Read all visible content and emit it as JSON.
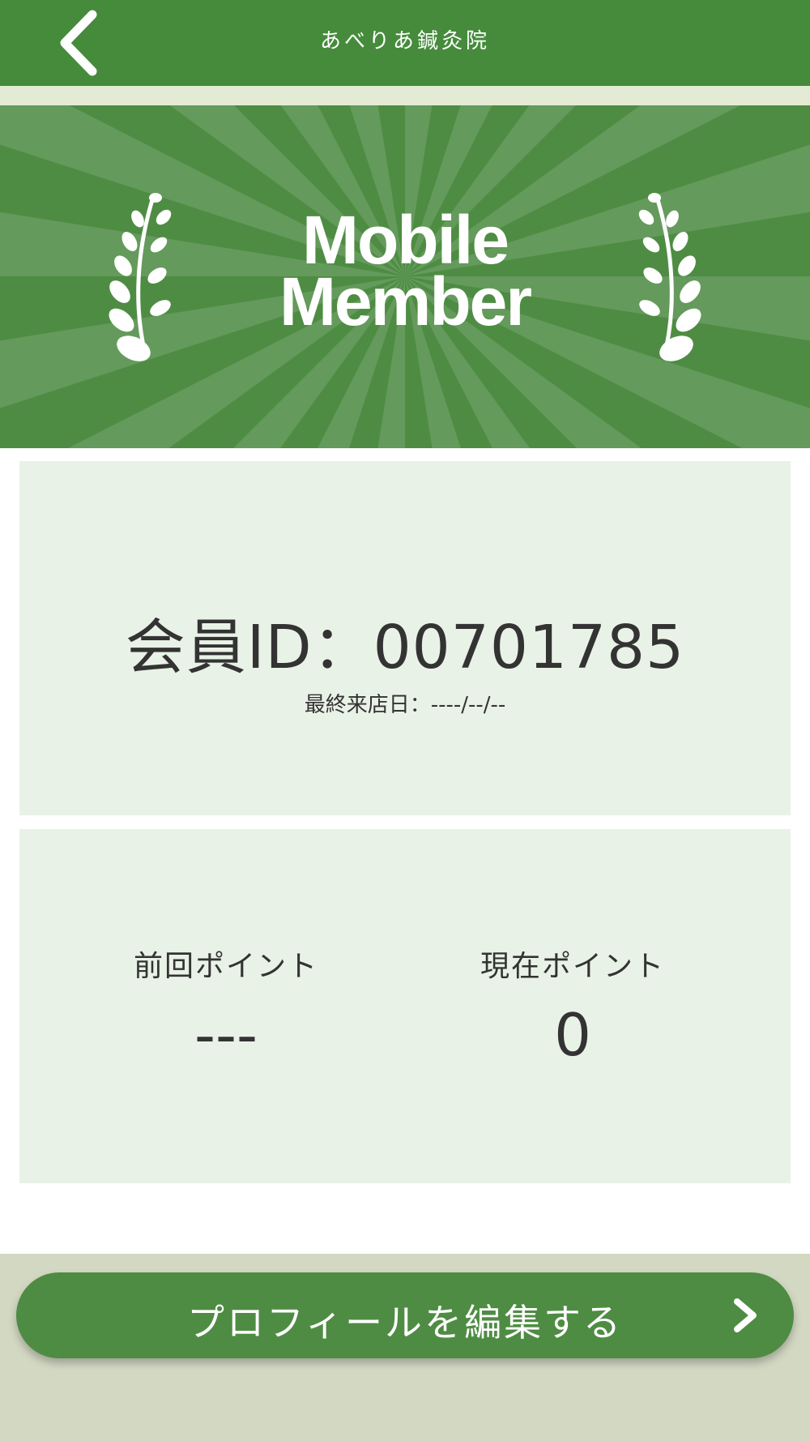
{
  "header": {
    "title": "あべりあ鍼灸院",
    "back_icon": "chevron-left-icon"
  },
  "banner": {
    "title_line1": "Mobile",
    "title_line2": "Member",
    "left_icon": "laurel-icon",
    "right_icon": "laurel-icon"
  },
  "member": {
    "id_text": "会員ID：00701785",
    "last_visit": "最終来店日：----/--/--"
  },
  "points": {
    "previous_label": "前回ポイント",
    "previous_value": "---",
    "current_label": "現在ポイント",
    "current_value": "0"
  },
  "edit_button": {
    "label": "プロフィールを編集する",
    "icon": "chevron-right-icon"
  },
  "colors": {
    "header_green": "#458b3b",
    "banner_green": "#4e8c43",
    "card_background": "#e9f2e6",
    "text": "#333333"
  }
}
